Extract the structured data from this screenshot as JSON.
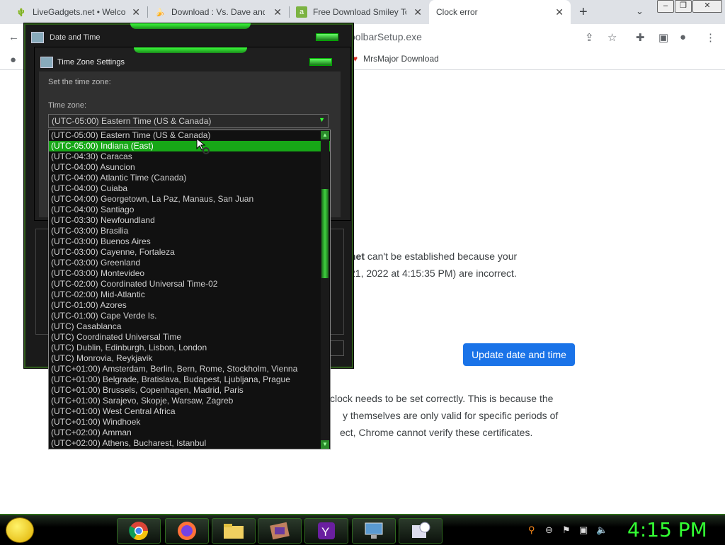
{
  "browser": {
    "tabs": [
      {
        "label": "LiveGadgets.net • Welcom",
        "icon": "livegadgets-favicon-icon"
      },
      {
        "label": "Download : Vs. Dave and",
        "icon": "banana-favicon-icon"
      },
      {
        "label": "Free Download Smiley To",
        "icon": "softonic-favicon-icon"
      },
      {
        "label": "Clock error",
        "active": true
      }
    ],
    "url_fragment": "oolbarSetup.exe",
    "bookmark": "MrsMajor Download"
  },
  "page": {
    "msg_line1_bold": "net",
    "msg_line1": " can't be established because your",
    "msg_line2": "21, 2022 at 4:15:35 PM) are incorrect.",
    "update_button": "Update date and time",
    "para_line1": "clock needs to be set correctly. This is because the",
    "para_line2": "y themselves are only valid for specific periods of",
    "para_line3": "ect, Chrome cannot verify these certificates."
  },
  "date_time_window": {
    "title": "Date and Time"
  },
  "tz_dialog": {
    "title": "Time Zone Settings",
    "instruction": "Set the time zone:",
    "tz_label": "Time zone:",
    "selected_value": "(UTC-05:00) Eastern Time (US & Canada)",
    "highlighted_index": 1,
    "options": [
      "(UTC-05:00) Eastern Time (US & Canada)",
      "(UTC-05:00) Indiana (East)",
      "(UTC-04:30) Caracas",
      "(UTC-04:00) Asuncion",
      "(UTC-04:00) Atlantic Time (Canada)",
      "(UTC-04:00) Cuiaba",
      "(UTC-04:00) Georgetown, La Paz, Manaus, San Juan",
      "(UTC-04:00) Santiago",
      "(UTC-03:30) Newfoundland",
      "(UTC-03:00) Brasilia",
      "(UTC-03:00) Buenos Aires",
      "(UTC-03:00) Cayenne, Fortaleza",
      "(UTC-03:00) Greenland",
      "(UTC-03:00) Montevideo",
      "(UTC-02:00) Coordinated Universal Time-02",
      "(UTC-02:00) Mid-Atlantic",
      "(UTC-01:00) Azores",
      "(UTC-01:00) Cape Verde Is.",
      "(UTC) Casablanca",
      "(UTC) Coordinated Universal Time",
      "(UTC) Dublin, Edinburgh, Lisbon, London",
      "(UTC) Monrovia, Reykjavik",
      "(UTC+01:00) Amsterdam, Berlin, Bern, Rome, Stockholm, Vienna",
      "(UTC+01:00) Belgrade, Bratislava, Budapest, Ljubljana, Prague",
      "(UTC+01:00) Brussels, Copenhagen, Madrid, Paris",
      "(UTC+01:00) Sarajevo, Skopje, Warsaw, Zagreb",
      "(UTC+01:00) West Central Africa",
      "(UTC+01:00) Windhoek",
      "(UTC+02:00) Amman",
      "(UTC+02:00) Athens, Bucharest, Istanbul"
    ]
  },
  "taskbar": {
    "clock": "4:15 PM",
    "apps": [
      "chrome-icon",
      "firefox-icon",
      "folder-icon",
      "media-player-icon",
      "yahoo-messenger-icon",
      "computer-icon",
      "calendar-clock-icon"
    ],
    "accent_color": "#33ff33"
  }
}
